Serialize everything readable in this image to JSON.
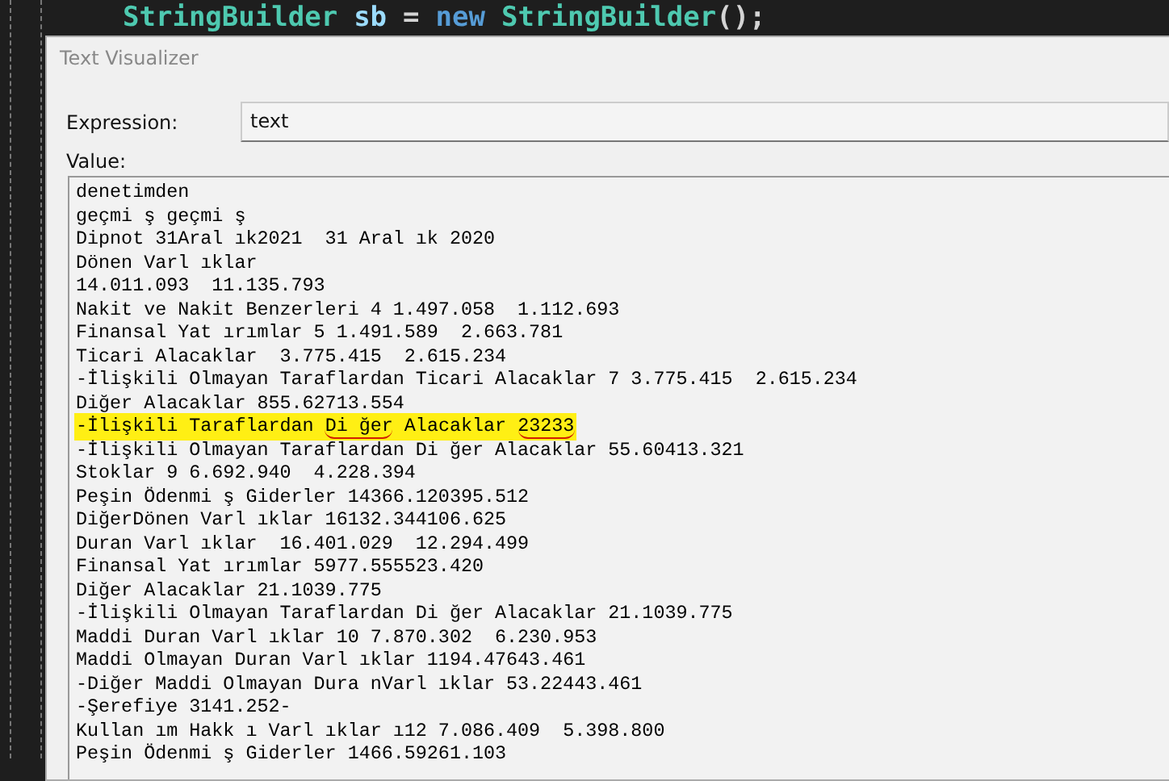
{
  "editor": {
    "code_tokens": [
      {
        "text": "StringBuilder",
        "kind": "type"
      },
      {
        "text": "sb",
        "kind": "variable"
      },
      {
        "text": "=",
        "kind": "operator"
      },
      {
        "text": "new",
        "kind": "keyword"
      },
      {
        "text": "StringBuilder",
        "kind": "type"
      },
      {
        "text": "();",
        "kind": "punct"
      }
    ]
  },
  "dialog": {
    "title": "Text Visualizer",
    "expression_label": "Expression:",
    "expression_value": "text",
    "value_label": "Value:",
    "lines": [
      {
        "segments": [
          {
            "text": "denetimden",
            "underlined": false
          }
        ],
        "highlighted": false
      },
      {
        "segments": [
          {
            "text": "geçmi ş geçmi ş",
            "underlined": false
          }
        ],
        "highlighted": false
      },
      {
        "segments": [
          {
            "text": "Dipnot 31Aral ık2021  31 Aral ık 2020",
            "underlined": false
          }
        ],
        "highlighted": false
      },
      {
        "segments": [
          {
            "text": "Dönen Varl ıklar",
            "underlined": false
          }
        ],
        "highlighted": false
      },
      {
        "segments": [
          {
            "text": "14.011.093  11.135.793",
            "underlined": false
          }
        ],
        "highlighted": false
      },
      {
        "segments": [
          {
            "text": "Nakit ve Nakit Benzerleri 4 1.497.058  1.112.693",
            "underlined": false
          }
        ],
        "highlighted": false
      },
      {
        "segments": [
          {
            "text": "Finansal Yat ırımlar 5 1.491.589  2.663.781",
            "underlined": false
          }
        ],
        "highlighted": false
      },
      {
        "segments": [
          {
            "text": "Ticari Alacaklar  3.775.415  2.615.234",
            "underlined": false
          }
        ],
        "highlighted": false
      },
      {
        "segments": [
          {
            "text": "-İlişkili Olmayan Taraflardan Ticari Alacaklar 7 3.775.415  2.615.234",
            "underlined": false
          }
        ],
        "highlighted": false
      },
      {
        "segments": [
          {
            "text": "Diğer Alacaklar 855.62713.554",
            "underlined": false
          }
        ],
        "highlighted": false
      },
      {
        "segments": [
          {
            "text": "-İlişkili Taraflardan ",
            "underlined": false
          },
          {
            "text": "Di ğer",
            "underlined": true
          },
          {
            "text": " Alacaklar ",
            "underlined": false
          },
          {
            "text": "23233",
            "underlined": true
          }
        ],
        "highlighted": true
      },
      {
        "segments": [
          {
            "text": "-İlişkili Olmayan Taraflardan Di ğer Alacaklar 55.60413.321",
            "underlined": false
          }
        ],
        "highlighted": false
      },
      {
        "segments": [
          {
            "text": "Stoklar 9 6.692.940  4.228.394",
            "underlined": false
          }
        ],
        "highlighted": false
      },
      {
        "segments": [
          {
            "text": "Peşin Ödenmi ş Giderler 14366.120395.512",
            "underlined": false
          }
        ],
        "highlighted": false
      },
      {
        "segments": [
          {
            "text": "DiğerDönen Varl ıklar 16132.344106.625",
            "underlined": false
          }
        ],
        "highlighted": false
      },
      {
        "segments": [
          {
            "text": "Duran Varl ıklar  16.401.029  12.294.499",
            "underlined": false
          }
        ],
        "highlighted": false
      },
      {
        "segments": [
          {
            "text": "Finansal Yat ırımlar 5977.555523.420",
            "underlined": false
          }
        ],
        "highlighted": false
      },
      {
        "segments": [
          {
            "text": "Diğer Alacaklar 21.1039.775",
            "underlined": false
          }
        ],
        "highlighted": false
      },
      {
        "segments": [
          {
            "text": "-İlişkili Olmayan Taraflardan Di ğer Alacaklar 21.1039.775",
            "underlined": false
          }
        ],
        "highlighted": false
      },
      {
        "segments": [
          {
            "text": "Maddi Duran Varl ıklar 10 7.870.302  6.230.953",
            "underlined": false
          }
        ],
        "highlighted": false
      },
      {
        "segments": [
          {
            "text": "Maddi Olmayan Duran Varl ıklar 1194.47643.461",
            "underlined": false
          }
        ],
        "highlighted": false
      },
      {
        "segments": [
          {
            "text": "-Diğer Maddi Olmayan Dura nVarl ıklar 53.22443.461",
            "underlined": false
          }
        ],
        "highlighted": false
      },
      {
        "segments": [
          {
            "text": "-Şerefiye 3141.252-",
            "underlined": false
          }
        ],
        "highlighted": false
      },
      {
        "segments": [
          {
            "text": "Kullan ım Hakk ı Varl ıklar ı12 7.086.409  5.398.800",
            "underlined": false
          }
        ],
        "highlighted": false
      },
      {
        "segments": [
          {
            "text": "Peşin Ödenmi ş Giderler 1466.59261.103",
            "underlined": false
          }
        ],
        "highlighted": false
      }
    ]
  }
}
